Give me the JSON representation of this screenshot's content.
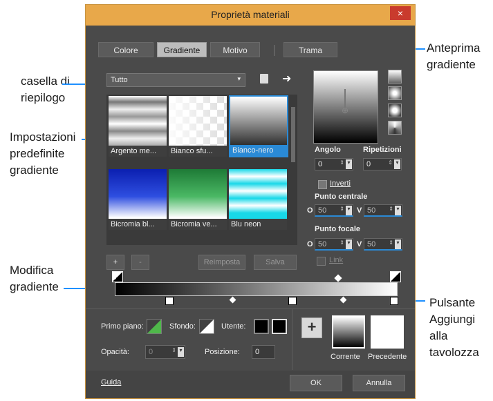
{
  "window": {
    "title": "Proprietà materiali",
    "close_glyph": "×"
  },
  "tabs": [
    {
      "label": "Colore",
      "active": false
    },
    {
      "label": "Gradiente",
      "active": true
    },
    {
      "label": "Motivo",
      "active": false
    },
    {
      "label": "Trama",
      "active": false
    }
  ],
  "dropdown": {
    "value": "Tutto"
  },
  "presets": [
    {
      "label": "Argento me..."
    },
    {
      "label": "Bianco sfu..."
    },
    {
      "label": "Bianco-nero",
      "selected": true
    },
    {
      "label": "Bicromia bl..."
    },
    {
      "label": "Bicromia ve..."
    },
    {
      "label": "Blu neon"
    }
  ],
  "preset_buttons": {
    "add": "+",
    "remove": "-",
    "reset": "Reimposta",
    "save": "Salva"
  },
  "right_panel": {
    "angle_label": "Angolo",
    "angle_value": "0",
    "repeat_label": "Ripetizioni",
    "repeat_value": "0",
    "invert_label": "Inverti",
    "center_label": "Punto centrale",
    "center_o_label": "O",
    "center_o_value": "50",
    "center_v_label": "V",
    "center_v_value": "50",
    "focal_label": "Punto focale",
    "focal_o_label": "O",
    "focal_o_value": "50",
    "focal_v_label": "V",
    "focal_v_value": "50",
    "link_label": "Link"
  },
  "bottom": {
    "foreground_label": "Primo piano:",
    "background_label": "Sfondo:",
    "user_label": "Utente:",
    "opacity_label": "Opacità:",
    "opacity_value": "0",
    "position_label": "Posizione:",
    "position_value": "0",
    "add_swatch": "+",
    "current_label": "Corrente",
    "previous_label": "Precedente",
    "help_link": "Guida",
    "ok_label": "OK",
    "cancel_label": "Annulla"
  },
  "callouts": {
    "dropdown_line1": "casella di",
    "dropdown_line2": "riepilogo",
    "presets_line1": "Impostazioni",
    "presets_line2": "predefinite",
    "presets_line3": "gradiente",
    "edit_line1": "Modifica",
    "edit_line2": "gradiente",
    "preview_line1": "Anteprima",
    "preview_line2": "gradiente",
    "add_line1": "Pulsante",
    "add_line2": "Aggiungi",
    "add_line3": "alla",
    "add_line4": "tavolozza"
  },
  "colors": {
    "titlebar": "#e8a84a",
    "dialog_bg": "#4a4a4a",
    "accent": "#1e90ff",
    "close": "#c93b2d"
  }
}
